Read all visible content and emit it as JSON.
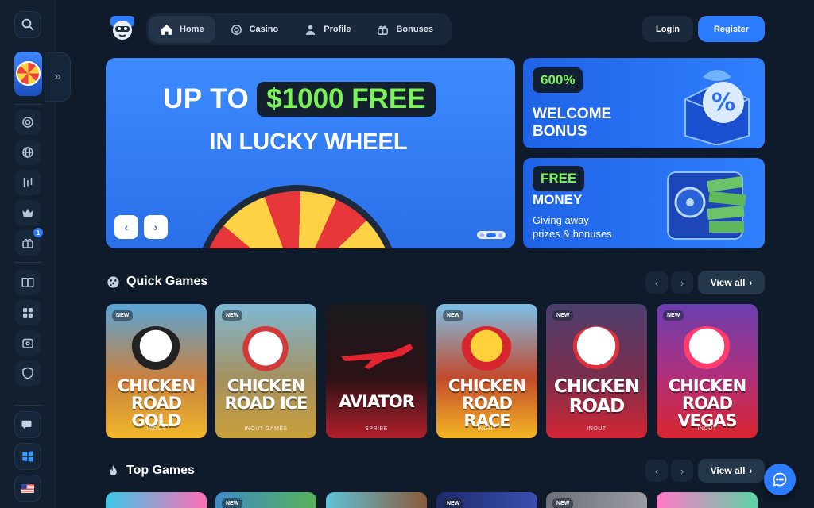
{
  "nav": {
    "items": [
      {
        "label": "Home",
        "icon": "home-icon",
        "active": true
      },
      {
        "label": "Casino",
        "icon": "chip-icon"
      },
      {
        "label": "Profile",
        "icon": "user-icon"
      },
      {
        "label": "Bonuses",
        "icon": "gift-icon"
      }
    ],
    "login": "Login",
    "register": "Register"
  },
  "sidebar": {
    "notification_count": "1"
  },
  "hero": {
    "line1_prefix": "UP TO",
    "line1_highlight": "$1000 FREE",
    "line2": "IN LUCKY WHEEL",
    "prev": "‹",
    "next": "›"
  },
  "promos": [
    {
      "pill": "600%",
      "title_1": "WELCOME",
      "title_2": "BONUS"
    },
    {
      "pill": "FREE",
      "title_1": "MONEY",
      "sub_1": "Giving away",
      "sub_2": "prizes & bonuses"
    }
  ],
  "quick_games": {
    "title": "Quick Games",
    "view_all": "View all",
    "games": [
      {
        "new": "NEW",
        "name": "CHICKEN ROAD GOLD",
        "provider": "INOUT"
      },
      {
        "new": "NEW",
        "name": "CHICKEN ROAD ICE",
        "provider": "INOUT GAMES"
      },
      {
        "new": "",
        "name": "AVIATOR",
        "provider": "SPRIBE"
      },
      {
        "new": "NEW",
        "name": "CHICKEN ROAD RACE",
        "provider": "INOUT"
      },
      {
        "new": "NEW",
        "name": "CHICKEN ROAD",
        "provider": "INOUT"
      },
      {
        "new": "NEW",
        "name": "CHICKEN ROAD VEGAS",
        "provider": "INOUT"
      }
    ]
  },
  "top_games": {
    "title": "Top Games",
    "view_all": "View all",
    "tiles": [
      {
        "new": ""
      },
      {
        "new": "NEW"
      },
      {
        "new": ""
      },
      {
        "new": "NEW"
      },
      {
        "new": "NEW"
      },
      {
        "new": ""
      }
    ]
  },
  "colors": {
    "accent": "#2b7cff",
    "highlight_green": "#7cf25a",
    "background": "#0f1b2a"
  }
}
